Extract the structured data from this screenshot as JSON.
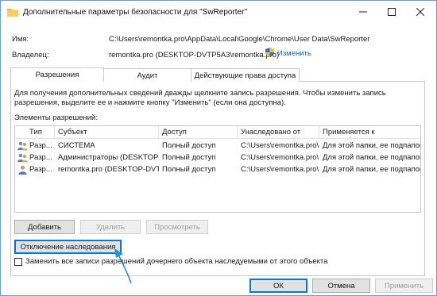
{
  "window": {
    "title": "Дополнительные параметры безопасности  для \"SwReporter\""
  },
  "fields": {
    "name_label": "Имя:",
    "name_value": "C:\\Users\\remontka.pro\\AppData\\Local\\Google\\Chrome\\User Data\\SwReporter",
    "owner_label": "Владелец:",
    "owner_value": "remontka.pro (DESKTOP-DVTP5A3\\remontka.pro)",
    "change_link": "Изменить"
  },
  "tabs": [
    {
      "label": "Разрешения",
      "active": true
    },
    {
      "label": "Аудит",
      "active": false
    },
    {
      "label": "Действующие права доступа",
      "active": false
    }
  ],
  "info_text": "Для получения дополнительных сведений дважды щелкните запись разрешения. Чтобы изменить запись разрешения, выделите ее и нажмите кнопку \"Изменить\" (если она доступна).",
  "permissions_label": "Элементы разрешений:",
  "table": {
    "headers": [
      "Тип",
      "Субъект",
      "Доступ",
      "Унаследовано от",
      "Применяется к"
    ],
    "rows": [
      {
        "type": "Разр...",
        "subject": "СИСТЕМА",
        "access": "Полный доступ",
        "inherited": "C:\\Users\\remontka.pro\\",
        "applies": "Для этой папки, ее подпапок ..."
      },
      {
        "type": "Разр...",
        "subject": "Администраторы (DESKTOP-...",
        "access": "Полный доступ",
        "inherited": "C:\\Users\\remontka.pro\\",
        "applies": "Для этой папки, ее подпапок ..."
      },
      {
        "type": "Разр...",
        "subject": "remontka.pro (DESKTOP-DVT...",
        "access": "Полный доступ",
        "inherited": "C:\\Users\\remontka.pro\\",
        "applies": "Для этой папки, ее подпапок ..."
      }
    ]
  },
  "buttons": {
    "add": "Добавить",
    "remove": "Удалить",
    "view": "Просмотреть",
    "disable_inheritance": "Отключение наследования",
    "ok": "ОК",
    "cancel": "Отмена",
    "apply": "Применить"
  },
  "checkbox_label": "Заменить все записи разрешений дочернего объекта наследуемыми от этого объекта",
  "colors": {
    "accent": "#0078d7",
    "link": "#1a5fb4",
    "arrow": "#2b8fd6"
  }
}
